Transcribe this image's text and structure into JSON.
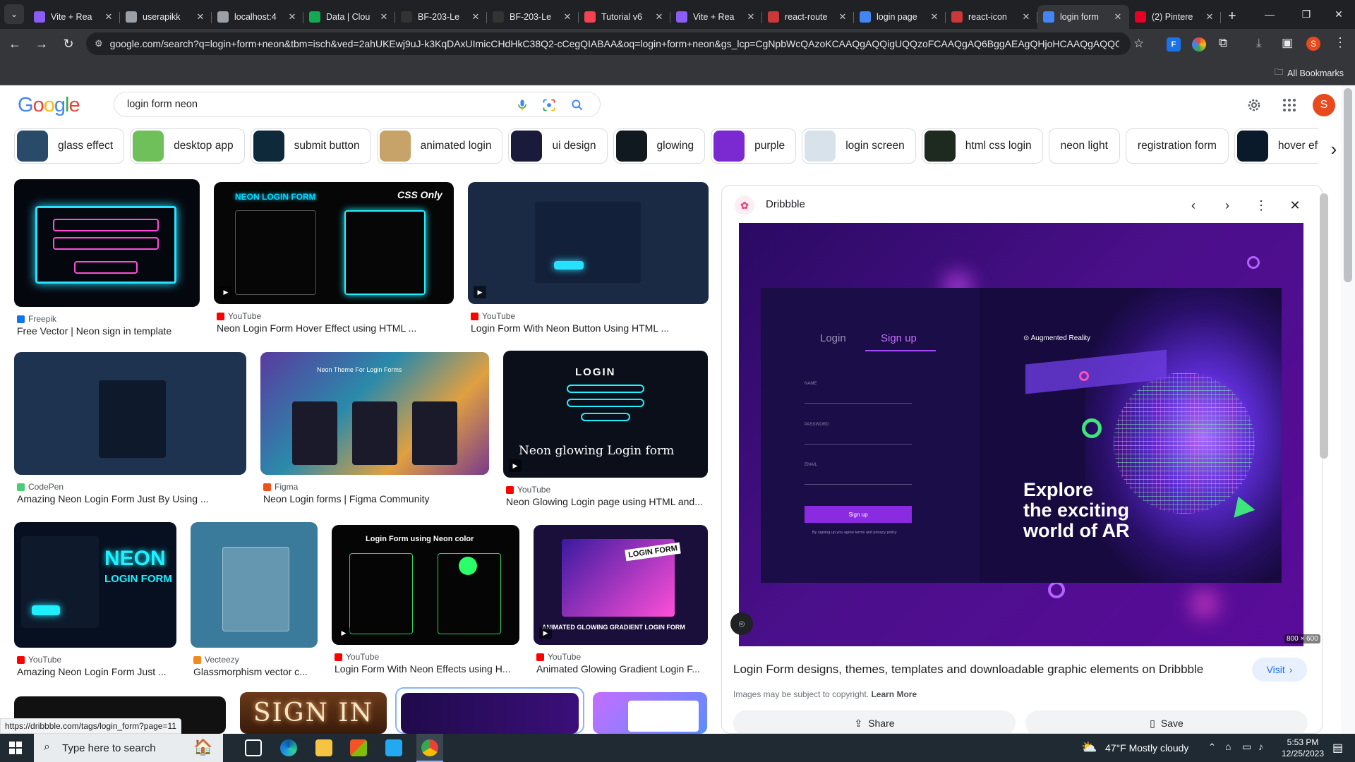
{
  "browser": {
    "tabs": [
      {
        "title": "Vite + Rea",
        "favicon": "vite-icon",
        "color": "#8b5cf6"
      },
      {
        "title": "userapikk",
        "favicon": "globe-icon",
        "color": "#9aa0a6"
      },
      {
        "title": "localhost:4",
        "favicon": "globe-icon",
        "color": "#9aa0a6"
      },
      {
        "title": "Data | Clou",
        "favicon": "mongodb-icon",
        "color": "#13aa52"
      },
      {
        "title": "BF-203-Le",
        "favicon": "github-icon",
        "color": "#333"
      },
      {
        "title": "BF-203-Le",
        "favicon": "github-icon",
        "color": "#333"
      },
      {
        "title": "Tutorial v6",
        "favicon": "react-router-icon",
        "color": "#f44250"
      },
      {
        "title": "Vite + Rea",
        "favicon": "vite-icon",
        "color": "#8b5cf6"
      },
      {
        "title": "react-route",
        "favicon": "npm-icon",
        "color": "#cb3837"
      },
      {
        "title": "login page",
        "favicon": "google-icon",
        "color": "#4285f4"
      },
      {
        "title": "react-icon",
        "favicon": "npm-icon",
        "color": "#cb3837"
      },
      {
        "title": "login form",
        "favicon": "google-icon",
        "color": "#4285f4",
        "active": true
      },
      {
        "title": "(2) Pintere",
        "favicon": "pinterest-icon",
        "color": "#e60023"
      }
    ],
    "url": "google.com/search?q=login+form+neon&tbm=isch&ved=2ahUKEwj9uJ-k3KqDAxUImicCHdHkC38Q2-cCegQIABAA&oq=login+form+neon&gs_lcp=CgNpbWcQAzoKCAAQgAQQigUQQzoFCAAQgAQ6BggAEAgQHjoHCAAQgAQQGF",
    "all_bookmarks_label": "All Bookmarks",
    "profile_initial": "S"
  },
  "google": {
    "logo": "Google",
    "query": "login form neon",
    "avatar_initial": "S"
  },
  "chips": [
    {
      "label": "glass effect",
      "thumb": "#2a4a6a"
    },
    {
      "label": "desktop app",
      "thumb": "#6fbf5a"
    },
    {
      "label": "submit button",
      "thumb": "#0e2a3a"
    },
    {
      "label": "animated login",
      "thumb": "#c7a36a"
    },
    {
      "label": "ui design",
      "thumb": "#1a1a3a"
    },
    {
      "label": "glowing",
      "thumb": "#101820"
    },
    {
      "label": "purple",
      "thumb": "#7a2ad0"
    },
    {
      "label": "login screen",
      "thumb": "#d8e2ea"
    },
    {
      "label": "html css login",
      "thumb": "#1e2a20"
    },
    {
      "label": "neon light",
      "thumb": ""
    },
    {
      "label": "registration form",
      "thumb": ""
    },
    {
      "label": "hover effect",
      "thumb": "#0a1a2a"
    }
  ],
  "results": [
    {
      "source": "Freepik",
      "title": "Free Vector | Neon sign in template",
      "src_color": "#1273eb"
    },
    {
      "source": "YouTube",
      "title": "Neon Login Form Hover Effect using HTML ...",
      "src_color": "#ff0000",
      "overlay": "NEON LOGIN FORM",
      "overlay2": "CSS Only"
    },
    {
      "source": "YouTube",
      "title": "Login Form With Neon Button Using HTML ...",
      "src_color": "#ff0000"
    },
    {
      "source": "CodePen",
      "title": "Amazing Neon Login Form Just By Using ...",
      "src_color": "#47cf73"
    },
    {
      "source": "Figma",
      "title": "Neon Login forms | Figma Community",
      "src_color": "#f24e1e",
      "overlay": "Neon Theme For Login Forms"
    },
    {
      "source": "YouTube",
      "title": "Neon Glowing Login page using HTML and...",
      "src_color": "#ff0000",
      "overlay": "LOGIN",
      "overlay2": "Neon glowing Login form"
    },
    {
      "source": "YouTube",
      "title": "Amazing Neon Login Form Just ...",
      "src_color": "#ff0000",
      "overlay": "NEON",
      "overlay2": "LOGIN FORM"
    },
    {
      "source": "Vecteezy",
      "title": "Glassmorphism vector c...",
      "src_color": "#f28a1b"
    },
    {
      "source": "YouTube",
      "title": "Login Form With Neon Effects using H...",
      "src_color": "#ff0000",
      "overlay": "Login Form using Neon color"
    },
    {
      "source": "YouTube",
      "title": "Animated Glowing Gradient Login F...",
      "src_color": "#ff0000",
      "overlay": "LOGIN FORM",
      "overlay2": "ANIMATED GLOWING GRADIENT LOGIN FORM"
    }
  ],
  "bottom_row": {
    "sign_in_text": "SIGN IN"
  },
  "panel": {
    "source": "Dribbble",
    "preview": {
      "tab_login": "Login",
      "tab_signup": "Sign up",
      "field_name": "NAME",
      "field_password": "PASSWORD",
      "field_email": "EMAIL",
      "signup_button": "Sign up",
      "terms": "By signing up you agree terms and privacy policy",
      "brand": "Augmented Reality",
      "headline_1": "Explore",
      "headline_2": "the exciting",
      "headline_3": "world of AR"
    },
    "dimensions": "800 × 600",
    "title": "Login Form designs, themes, templates and downloadable graphic elements on Dribbble",
    "visit_label": "Visit",
    "copyright": "Images may be subject to copyright.",
    "learn_more": "Learn More",
    "share_label": "Share",
    "save_label": "Save"
  },
  "status_url": "https://dribbble.com/tags/login_form?page=11",
  "taskbar": {
    "search_placeholder": "Type here to search",
    "weather": "47°F  Mostly cloudy",
    "time": "5:53 PM",
    "date": "12/25/2023"
  }
}
